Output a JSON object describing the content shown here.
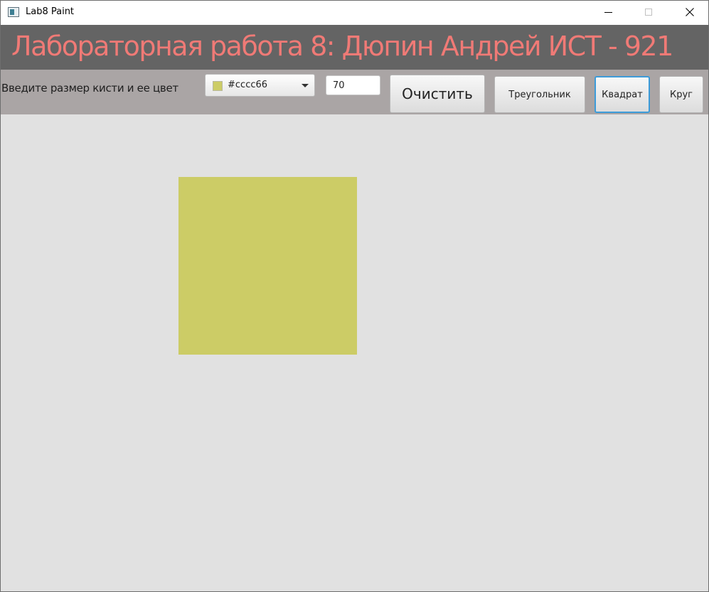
{
  "window": {
    "title": "Lab8 Paint"
  },
  "header": {
    "title": "Лабораторная работа 8: Дюпин Андрей ИСТ - 921",
    "color": "#f07a76"
  },
  "toolbar": {
    "prompt_label": "Введите размер кисти и ее цвет",
    "color_picker": {
      "value": "#cccc66"
    },
    "brush_size": "70",
    "clear_label": "Очистить",
    "triangle_label": "Треугольник",
    "square_label": "Квадрат",
    "circle_label": "Круг",
    "selected_tool": "square"
  },
  "canvas": {
    "shapes": [
      {
        "type": "square",
        "color": "#cccc66"
      }
    ]
  },
  "icons": {
    "app": "app-window-icon",
    "minimize": "minimize-icon",
    "maximize": "maximize-icon",
    "close": "close-icon",
    "dropdown": "chevron-down-icon"
  }
}
